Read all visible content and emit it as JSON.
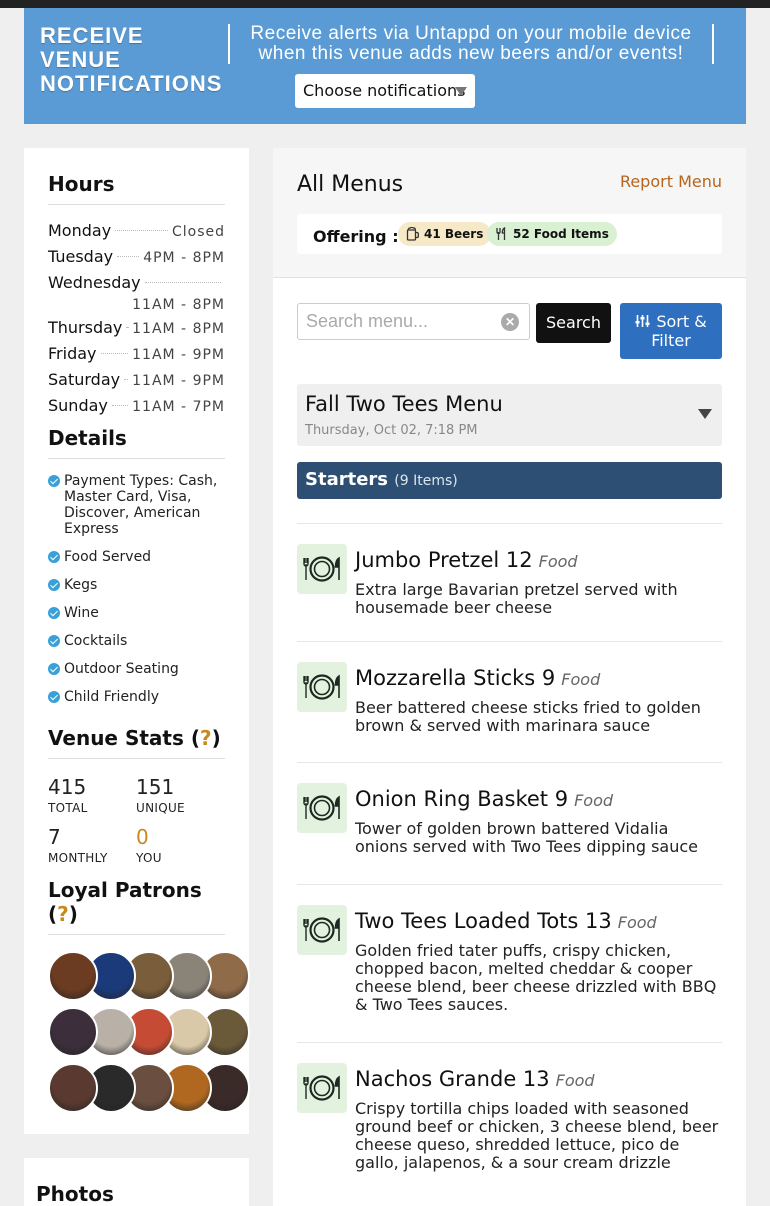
{
  "notify": {
    "title": "RECEIVE VENUE NOTIFICATIONS",
    "description": "Receive alerts via Untappd on your mobile device when this venue adds new beers and/or events!",
    "select_label": "Choose notifications"
  },
  "hours": {
    "heading": "Hours",
    "rows": [
      {
        "day": "Monday",
        "time": "Closed"
      },
      {
        "day": "Tuesday",
        "time": "4PM - 8PM"
      },
      {
        "day": "Wednesday",
        "time": "11AM - 8PM"
      },
      {
        "day": "Thursday",
        "time": "11AM - 8PM"
      },
      {
        "day": "Friday",
        "time": "11AM - 9PM"
      },
      {
        "day": "Saturday",
        "time": "11AM - 9PM"
      },
      {
        "day": "Sunday",
        "time": "11AM - 7PM"
      }
    ]
  },
  "details": {
    "heading": "Details",
    "items": [
      "Payment Types: Cash, Master Card, Visa, Discover, American Express",
      "Food Served",
      "Kegs",
      "Wine",
      "Cocktails",
      "Outdoor Seating",
      "Child Friendly"
    ]
  },
  "stats": {
    "heading": "Venue Stats (",
    "q": "?",
    "close": ")",
    "total": "415",
    "total_label": "TOTAL",
    "unique": "151",
    "unique_label": "UNIQUE",
    "monthly": "7",
    "monthly_label": "MONTHLY",
    "you": "0",
    "you_label": "YOU"
  },
  "patrons": {
    "heading": "Loyal Patrons (",
    "q": "?",
    "close": ")",
    "avatar_colors": [
      "#6b3b22",
      "#1b3a7a",
      "#7a5d3a",
      "#8a8478",
      "#8f6b4a",
      "#3c2f3b",
      "#b9b0a8",
      "#c54b35",
      "#d9c9a8",
      "#6a5a3a",
      "#5a3a30",
      "#2a2a2a",
      "#6a4f40",
      "#b06820",
      "#3a2a28"
    ]
  },
  "photos": {
    "heading": "Photos"
  },
  "main": {
    "title": "All Menus",
    "report": "Report Menu",
    "offering_label": "Offering :",
    "beers": "41 Beers",
    "food": "52 Food Items",
    "search_placeholder": "Search menu...",
    "search_clear": "✕",
    "search_button": "Search",
    "sort_button": "Sort & Filter",
    "menu_name": "Fall Two Tees Menu",
    "menu_date": "Thursday, Oct 02, 7:18 PM",
    "section_title": "Starters",
    "section_count": "(9 Items)"
  },
  "items": [
    {
      "name": "Jumbo Pretzel 12",
      "type": "Food",
      "desc": "Extra large Bavarian pretzel served with housemade beer cheese"
    },
    {
      "name": "Mozzarella Sticks 9",
      "type": "Food",
      "desc": "Beer battered cheese sticks fried to golden brown & served with marinara sauce"
    },
    {
      "name": "Onion Ring Basket 9",
      "type": "Food",
      "desc": "Tower of golden brown battered Vidalia onions served with Two Tees dipping sauce"
    },
    {
      "name": "Two Tees Loaded Tots 13",
      "type": "Food",
      "desc": "Golden fried tater puffs, crispy chicken, chopped bacon, melted cheddar & cooper cheese blend, beer cheese drizzled with BBQ & Two Tees sauces."
    },
    {
      "name": "Nachos Grande 13",
      "type": "Food",
      "desc": "Crispy tortilla chips loaded with seasoned ground beef or chicken, 3 cheese blend, beer cheese queso, shredded lettuce, pico de gallo, jalapenos, & a sour cream drizzle"
    }
  ]
}
